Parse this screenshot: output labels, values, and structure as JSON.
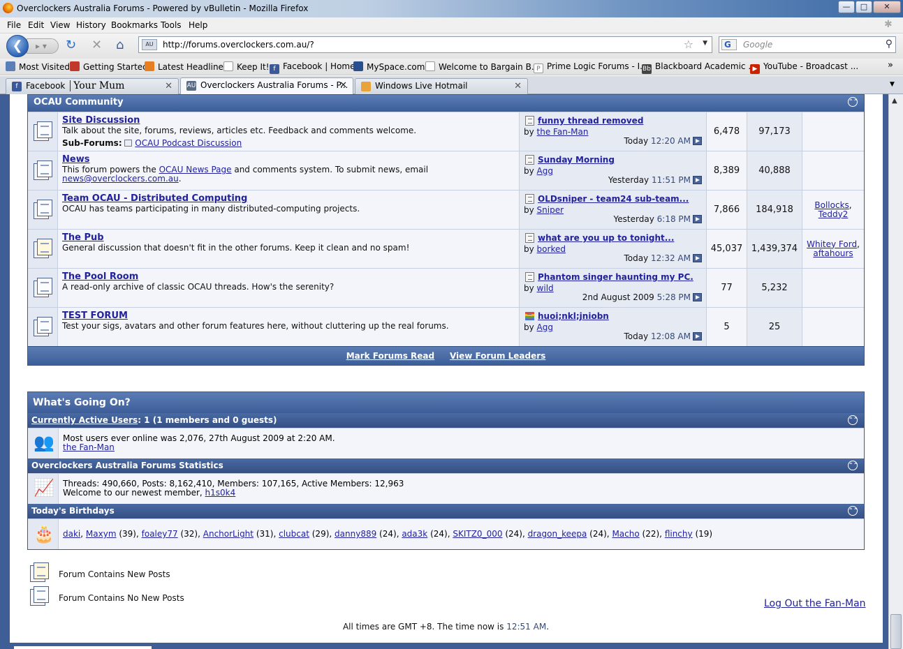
{
  "window": {
    "title": "Overclockers Australia Forums - Powered by vBulletin - Mozilla Firefox",
    "min": "—",
    "max": "□",
    "close": "✕"
  },
  "menu": [
    "File",
    "Edit",
    "View",
    "History",
    "Bookmarks",
    "Tools",
    "Help"
  ],
  "nav": {
    "url": "http://forums.overclockers.com.au/?",
    "favicon_text": "AU",
    "search_placeholder": "Google",
    "search_engine": "G"
  },
  "bookmarks": [
    {
      "label": "Most Visited",
      "color": "#5a7fb8"
    },
    {
      "label": "Getting Started",
      "color": "#c0392b"
    },
    {
      "label": "Latest Headlines",
      "color": "#e67e22"
    },
    {
      "label": "Keep It!",
      "color": "#dddddd"
    },
    {
      "label": "Facebook | Home",
      "color": "#3b5998"
    },
    {
      "label": "MySpace.com",
      "color": "#2a4f8f"
    },
    {
      "label": "Welcome to Bargain B...",
      "color": "#dddddd"
    },
    {
      "label": "Prime Logic Forums - I...",
      "color": "#6b6b9b"
    },
    {
      "label": "Blackboard Academic ...",
      "color": "#444444"
    },
    {
      "label": "YouTube - Broadcast ...",
      "color": "#cc2200"
    }
  ],
  "tabs": [
    {
      "label": "Facebook",
      "extra": "Your Mum",
      "color": "#3b5998"
    },
    {
      "label": "Overclockers Australia Forums - P...",
      "color": "#5a6b86"
    },
    {
      "label": "Windows Live Hotmail",
      "color": "#e8a33a"
    }
  ],
  "category": {
    "title": "OCAU Community"
  },
  "forums": [
    {
      "title": "Site Discussion",
      "desc": "Talk about the site, forums, reviews, articles etc. Feedback and comments welcome.",
      "subforums_label": "Sub-Forums:",
      "subforum": "OCAU Podcast Discussion",
      "last_title": "funny thread removed",
      "by": "by",
      "last_user": "the Fan-Man",
      "last_day": "Today",
      "last_time": "12:20 AM",
      "threads": "6,478",
      "posts": "97,173",
      "mods": []
    },
    {
      "title": "News",
      "desc_pre": "This forum powers the ",
      "desc_link": "OCAU News Page",
      "desc_post": " and comments system. To submit news, email",
      "desc_email": "news@overclockers.com.au",
      "last_title": "Sunday Morning",
      "by": "by",
      "last_user": "Agg",
      "last_day": "Yesterday",
      "last_time": "11:51 PM",
      "threads": "8,389",
      "posts": "40,888",
      "mods": []
    },
    {
      "title": "Team OCAU - Distributed Computing",
      "desc": "OCAU has teams participating in many distributed-computing projects.",
      "last_title": "OLDsniper - team24 sub-team...",
      "by": "by",
      "last_user": "Sniper",
      "last_day": "Yesterday",
      "last_time": "6:18 PM",
      "threads": "7,866",
      "posts": "184,918",
      "mods": [
        "Bollocks",
        "Teddy2"
      ]
    },
    {
      "title": "The Pub",
      "desc": "General discussion that doesn't fit in the other forums. Keep it clean and no spam!",
      "last_title": "what are you up to tonight...",
      "by": "by",
      "last_user": "borked",
      "last_day": "Today",
      "last_time": "12:32 AM",
      "threads": "45,037",
      "posts": "1,439,374",
      "mods": [
        "Whitey Ford",
        "aftahours"
      ]
    },
    {
      "title": "The Pool Room",
      "desc": "A read-only archive of classic OCAU threads. How's the serenity?",
      "last_title": "Phantom singer haunting my PC.",
      "by": "by",
      "last_user": "wild",
      "last_day": "2nd August 2009",
      "last_time": "5:28 PM",
      "threads": "77",
      "posts": "5,232",
      "mods": []
    },
    {
      "title": "TEST FORUM",
      "desc": "Test your sigs, avatars and other forum features here, without cluttering up the real forums.",
      "last_title": "huoi;nkl;jniobn",
      "by": "by",
      "last_user": "Agg",
      "last_day": "Today",
      "last_time": "12:08 AM",
      "threads": "5",
      "posts": "25",
      "mods": []
    }
  ],
  "forum_footer": {
    "mark_read": "Mark Forums Read",
    "leaders": "View Forum Leaders"
  },
  "wgo": {
    "title": "What's Going On?",
    "active_link": "Currently Active Users",
    "active_rest": ": 1 (1 members and 0 guests)",
    "most_online": "Most users ever online was 2,076, 27th August 2009 at 2:20 AM.",
    "online_user": "the Fan-Man",
    "stats_title": "Overclockers Australia Forums Statistics",
    "stats": "Threads: 490,660, Posts: 8,162,410, Members: 107,165, Active Members: 12,963",
    "newest_pre": "Welcome to our newest member, ",
    "newest": "h1s0k4",
    "bday_title": "Today's Birthdays",
    "birthdays": [
      {
        "name": "daki",
        "age": ""
      },
      {
        "name": "Maxym",
        "age": "(39)"
      },
      {
        "name": "foaley77",
        "age": "(32)"
      },
      {
        "name": "AnchorLight",
        "age": "(31)"
      },
      {
        "name": "clubcat",
        "age": "(29)"
      },
      {
        "name": "danny889",
        "age": "(24)"
      },
      {
        "name": "ada3k",
        "age": "(24)"
      },
      {
        "name": "SKITZ0_000",
        "age": "(24)"
      },
      {
        "name": "dragon_keepa",
        "age": "(24)"
      },
      {
        "name": "Macho",
        "age": "(22)"
      },
      {
        "name": "flinchy",
        "age": "(19)"
      }
    ]
  },
  "legend": {
    "new_posts": "Forum Contains New Posts",
    "no_new_posts": "Forum Contains No New Posts"
  },
  "logout": "Log Out the Fan-Man",
  "time_note": {
    "pre": "All times are GMT +8. The time now is ",
    "time": "12:51 AM",
    "post": "."
  }
}
